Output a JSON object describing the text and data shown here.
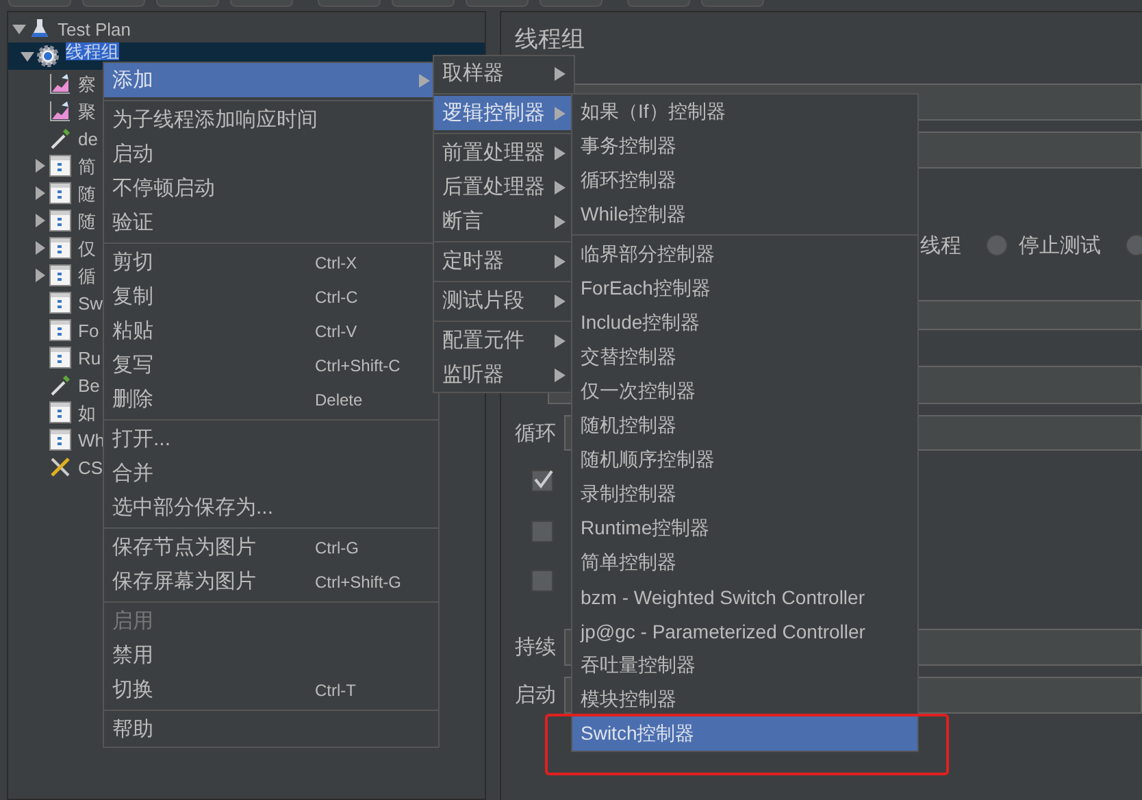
{
  "tree": [
    {
      "label": "Test Plan",
      "kind": "plan",
      "expanded": true,
      "selected": false,
      "children": [
        {
          "label": "线程组",
          "kind": "group",
          "expanded": true,
          "selected": true,
          "children": [
            {
              "label": "察",
              "kind": "listener",
              "selected": false
            },
            {
              "label": "聚",
              "kind": "listener",
              "selected": false
            },
            {
              "label": "de",
              "kind": "pipette",
              "selected": false
            },
            {
              "label": "简",
              "kind": "controller",
              "expanded": false,
              "selected": false
            },
            {
              "label": "随",
              "kind": "controller",
              "expanded": false,
              "selected": false
            },
            {
              "label": "随",
              "kind": "controller",
              "expanded": false,
              "selected": false
            },
            {
              "label": "仅",
              "kind": "controller",
              "expanded": false,
              "selected": false
            },
            {
              "label": "循",
              "kind": "controller",
              "expanded": false,
              "selected": false
            },
            {
              "label": "Sw",
              "kind": "controller",
              "selected": false
            },
            {
              "label": "Fo",
              "kind": "controller",
              "selected": false
            },
            {
              "label": "Ru",
              "kind": "controller",
              "selected": false
            },
            {
              "label": "Be",
              "kind": "pipette",
              "selected": false
            },
            {
              "label": "如",
              "kind": "controller",
              "selected": false
            },
            {
              "label": "Wh",
              "kind": "controller",
              "selected": false
            },
            {
              "label": "CS",
              "kind": "tools",
              "selected": false
            }
          ]
        }
      ]
    }
  ],
  "form": {
    "title": "线程组",
    "rows": [
      {
        "kind": "field"
      },
      {
        "kind": "field"
      },
      {
        "kind": "radios",
        "label": "线程",
        "options": [
          {
            "label": "停止测试",
            "selected": false
          },
          {
            "selected": false
          }
        ]
      },
      {
        "kind": "field"
      },
      {
        "kind": "field"
      },
      {
        "kind": "field",
        "label": "循环"
      },
      {
        "kind": "checkbox",
        "checked": true
      },
      {
        "kind": "checkbox",
        "checked": false
      },
      {
        "kind": "checkbox",
        "checked": false
      },
      {
        "kind": "field",
        "label": "持续"
      },
      {
        "kind": "field",
        "label": "启动"
      }
    ]
  },
  "menus": [
    {
      "items": [
        {
          "kind": "item",
          "label": "添加",
          "submenu": true,
          "selected": true,
          "disabled": false
        },
        {
          "kind": "separator"
        },
        {
          "kind": "item",
          "label": "为子线程添加响应时间",
          "selected": false,
          "disabled": false
        },
        {
          "kind": "item",
          "label": "启动",
          "selected": false,
          "disabled": false
        },
        {
          "kind": "item",
          "label": "不停顿启动",
          "selected": false,
          "disabled": false
        },
        {
          "kind": "item",
          "label": "验证",
          "selected": false,
          "disabled": false
        },
        {
          "kind": "separator"
        },
        {
          "kind": "item",
          "label": "剪切",
          "shortcut": "Ctrl-X",
          "selected": false,
          "disabled": false
        },
        {
          "kind": "item",
          "label": "复制",
          "shortcut": "Ctrl-C",
          "selected": false,
          "disabled": false
        },
        {
          "kind": "item",
          "label": "粘贴",
          "shortcut": "Ctrl-V",
          "selected": false,
          "disabled": false
        },
        {
          "kind": "item",
          "label": "复写",
          "shortcut": "Ctrl+Shift-C",
          "selected": false,
          "disabled": false
        },
        {
          "kind": "item",
          "label": "删除",
          "shortcut": "Delete",
          "selected": false,
          "disabled": false
        },
        {
          "kind": "separator"
        },
        {
          "kind": "item",
          "label": "打开...",
          "selected": false,
          "disabled": false
        },
        {
          "kind": "item",
          "label": "合并",
          "selected": false,
          "disabled": false
        },
        {
          "kind": "item",
          "label": "选中部分保存为...",
          "selected": false,
          "disabled": false
        },
        {
          "kind": "separator"
        },
        {
          "kind": "item",
          "label": "保存节点为图片",
          "shortcut": "Ctrl-G",
          "selected": false,
          "disabled": false
        },
        {
          "kind": "item",
          "label": "保存屏幕为图片",
          "shortcut": "Ctrl+Shift-G",
          "selected": false,
          "disabled": false
        },
        {
          "kind": "separator"
        },
        {
          "kind": "item",
          "label": "启用",
          "selected": false,
          "disabled": true
        },
        {
          "kind": "item",
          "label": "禁用",
          "selected": false,
          "disabled": false
        },
        {
          "kind": "item",
          "label": "切换",
          "shortcut": "Ctrl-T",
          "selected": false,
          "disabled": false
        },
        {
          "kind": "separator"
        },
        {
          "kind": "item",
          "label": "帮助",
          "selected": false,
          "disabled": false
        }
      ]
    },
    {
      "items": [
        {
          "kind": "item",
          "label": "取样器",
          "submenu": true,
          "selected": false,
          "disabled": false
        },
        {
          "kind": "separator"
        },
        {
          "kind": "item",
          "label": "逻辑控制器",
          "submenu": true,
          "selected": true,
          "disabled": false
        },
        {
          "kind": "separator"
        },
        {
          "kind": "item",
          "label": "前置处理器",
          "submenu": true,
          "selected": false,
          "disabled": false
        },
        {
          "kind": "item",
          "label": "后置处理器",
          "submenu": true,
          "selected": false,
          "disabled": false
        },
        {
          "kind": "item",
          "label": "断言",
          "submenu": true,
          "selected": false,
          "disabled": false
        },
        {
          "kind": "separator"
        },
        {
          "kind": "item",
          "label": "定时器",
          "submenu": true,
          "selected": false,
          "disabled": false
        },
        {
          "kind": "separator"
        },
        {
          "kind": "item",
          "label": "测试片段",
          "submenu": true,
          "selected": false,
          "disabled": false
        },
        {
          "kind": "separator"
        },
        {
          "kind": "item",
          "label": "配置元件",
          "submenu": true,
          "selected": false,
          "disabled": false
        },
        {
          "kind": "item",
          "label": "监听器",
          "submenu": true,
          "selected": false,
          "disabled": false
        }
      ]
    },
    {
      "items": [
        {
          "kind": "item",
          "label": "如果（If）控制器",
          "selected": false,
          "disabled": false
        },
        {
          "kind": "item",
          "label": "事务控制器",
          "selected": false,
          "disabled": false
        },
        {
          "kind": "item",
          "label": "循环控制器",
          "selected": false,
          "disabled": false
        },
        {
          "kind": "item",
          "label": "While控制器",
          "selected": false,
          "disabled": false
        },
        {
          "kind": "separator"
        },
        {
          "kind": "item",
          "label": "临界部分控制器",
          "selected": false,
          "disabled": false
        },
        {
          "kind": "item",
          "label": "ForEach控制器",
          "selected": false,
          "disabled": false
        },
        {
          "kind": "item",
          "label": "Include控制器",
          "selected": false,
          "disabled": false
        },
        {
          "kind": "item",
          "label": "交替控制器",
          "selected": false,
          "disabled": false
        },
        {
          "kind": "item",
          "label": "仅一次控制器",
          "selected": false,
          "disabled": false
        },
        {
          "kind": "item",
          "label": "随机控制器",
          "selected": false,
          "disabled": false
        },
        {
          "kind": "item",
          "label": "随机顺序控制器",
          "selected": false,
          "disabled": false
        },
        {
          "kind": "item",
          "label": "录制控制器",
          "selected": false,
          "disabled": false
        },
        {
          "kind": "item",
          "label": "Runtime控制器",
          "selected": false,
          "disabled": false
        },
        {
          "kind": "item",
          "label": "简单控制器",
          "selected": false,
          "disabled": false
        },
        {
          "kind": "item",
          "label": "bzm - Weighted Switch Controller",
          "selected": false,
          "disabled": false
        },
        {
          "kind": "item",
          "label": "jp@gc - Parameterized Controller",
          "selected": false,
          "disabled": false
        },
        {
          "kind": "item",
          "label": "吞吐量控制器",
          "selected": false,
          "disabled": false
        },
        {
          "kind": "item",
          "label": "模块控制器",
          "selected": false,
          "disabled": false
        },
        {
          "kind": "item",
          "label": "Switch控制器",
          "selected": true,
          "disabled": false
        }
      ]
    }
  ],
  "highlight": {
    "color": "#e02020"
  }
}
